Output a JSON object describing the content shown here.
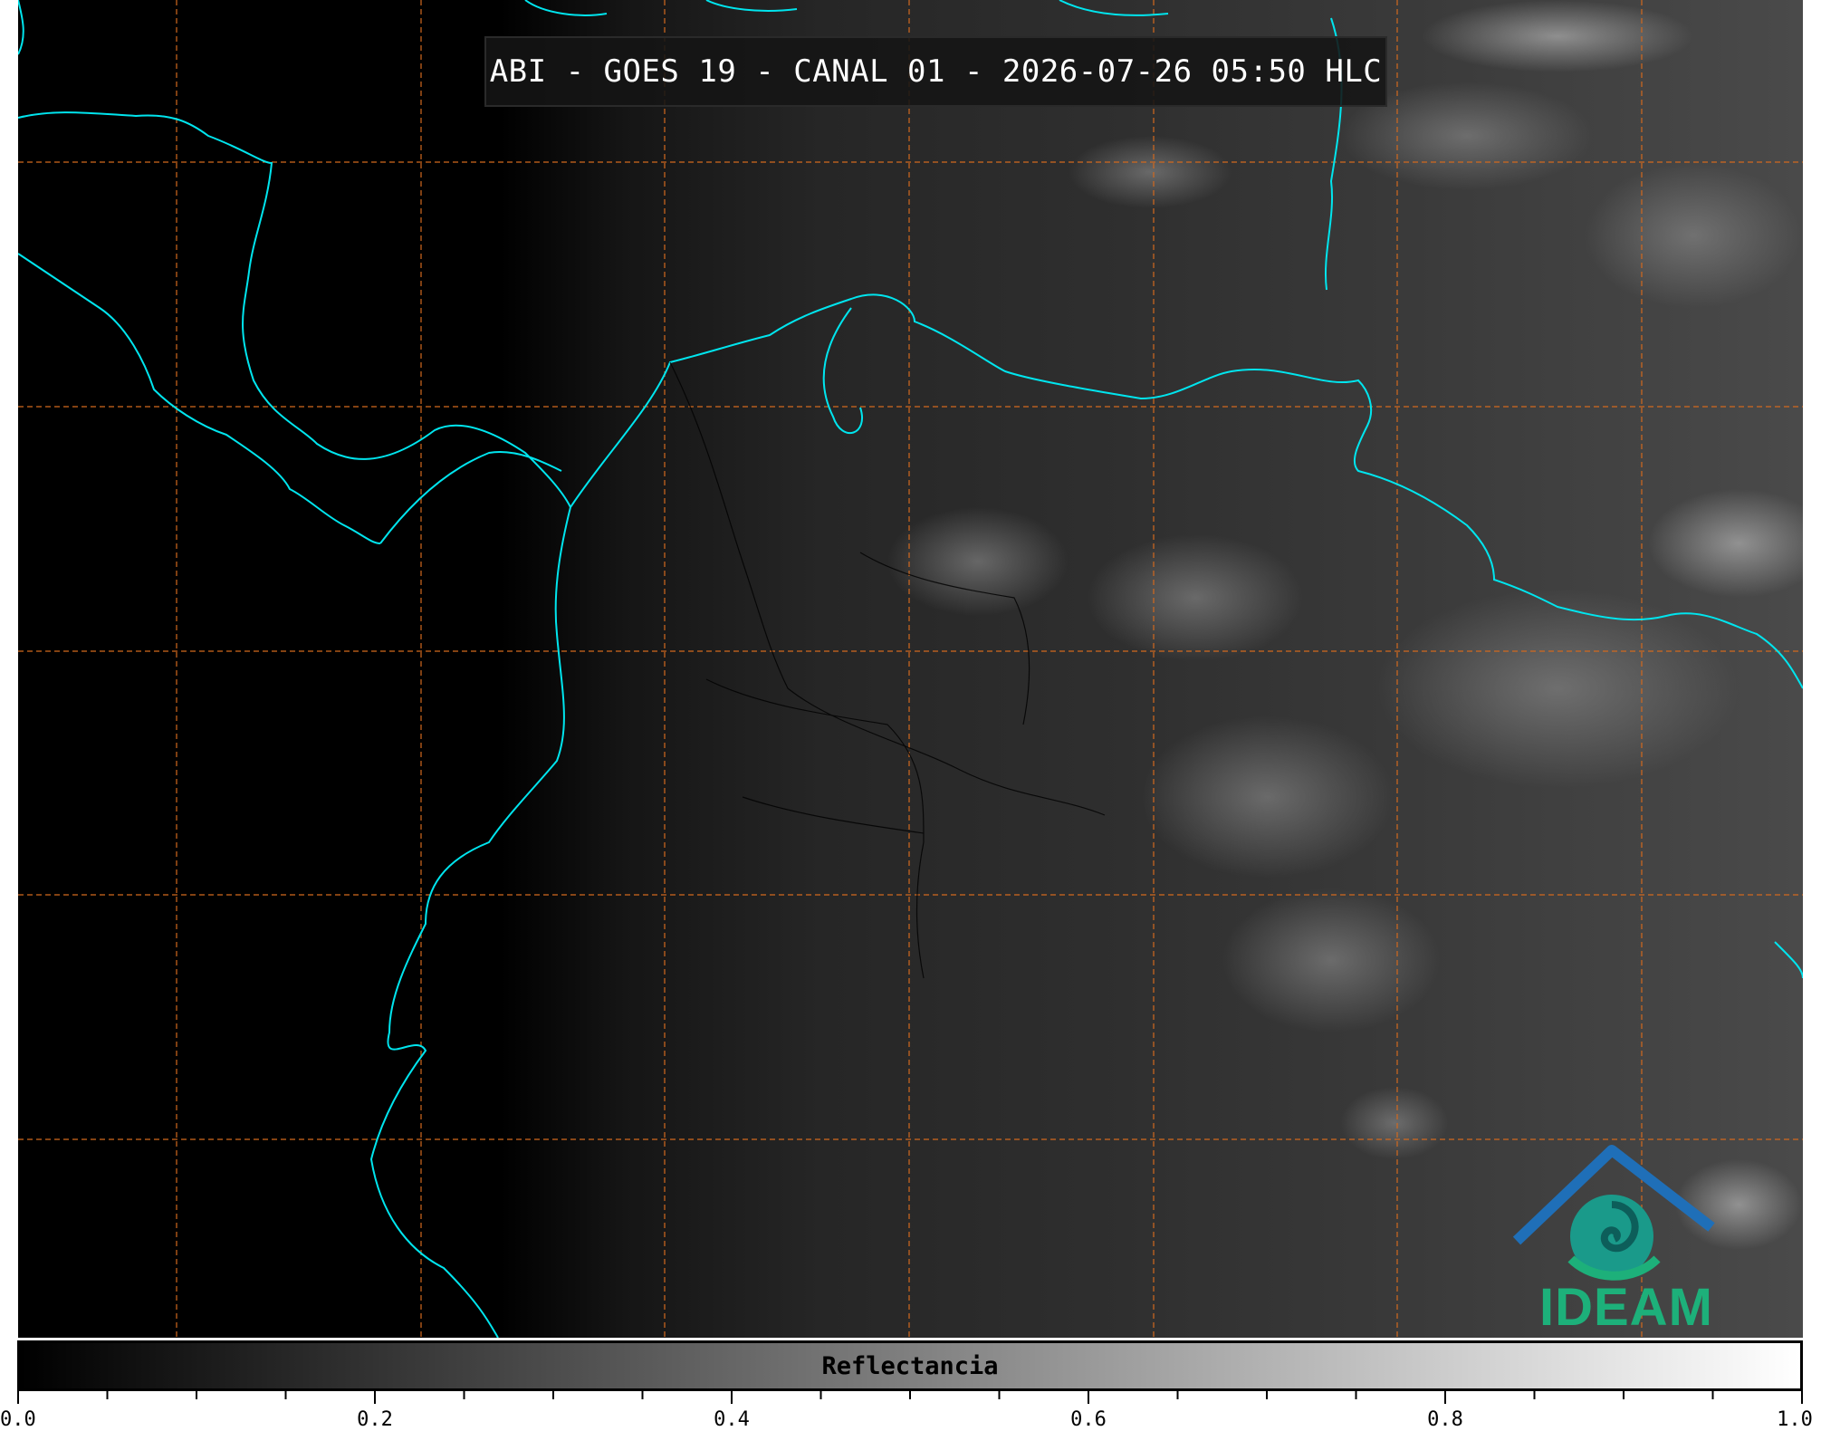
{
  "map": {
    "title": "ABI - GOES 19 - CANAL 01 - 2026-07-26 05:50 HLC",
    "coastline_color": "#00e5ee",
    "border_color": "#000000",
    "grid_color": "#d2691e"
  },
  "logo": {
    "text": "IDEAM",
    "colors": [
      "#1f6fb8",
      "#1db07a"
    ]
  },
  "colorbar": {
    "label": "Reflectancia",
    "range": [
      0.0,
      1.0
    ],
    "major_ticks": [
      "0.0",
      "0.2",
      "0.4",
      "0.6",
      "0.8",
      "1.0"
    ],
    "minor_step": 0.05
  }
}
